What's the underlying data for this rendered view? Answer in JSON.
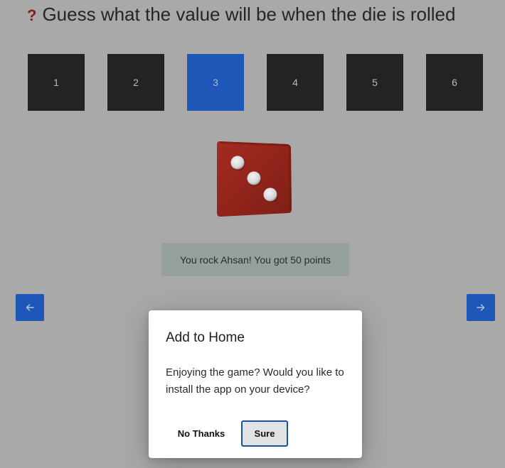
{
  "title": {
    "icon": "question-mark-icon",
    "icon_glyph": "?",
    "text": "Guess what the value will be when the die is rolled"
  },
  "choices": [
    {
      "label": "1",
      "selected": false
    },
    {
      "label": "2",
      "selected": false
    },
    {
      "label": "3",
      "selected": true
    },
    {
      "label": "4",
      "selected": false
    },
    {
      "label": "5",
      "selected": false
    },
    {
      "label": "6",
      "selected": false
    }
  ],
  "die": {
    "value": 3,
    "color": "#b5271c",
    "pip_color": "#e8e8e8"
  },
  "result_message": "You rock Ahsan! You got 50 points",
  "navigation": {
    "prev_icon": "arrow-left-icon",
    "next_icon": "arrow-right-icon"
  },
  "dialog": {
    "title": "Add to Home",
    "body": "Enjoying the game? Would you like to install the app on your device?",
    "cancel_label": "No Thanks",
    "confirm_label": "Sure"
  },
  "colors": {
    "accent": "#1f57b8",
    "tile": "#232323",
    "background": "#a9a9a9"
  }
}
